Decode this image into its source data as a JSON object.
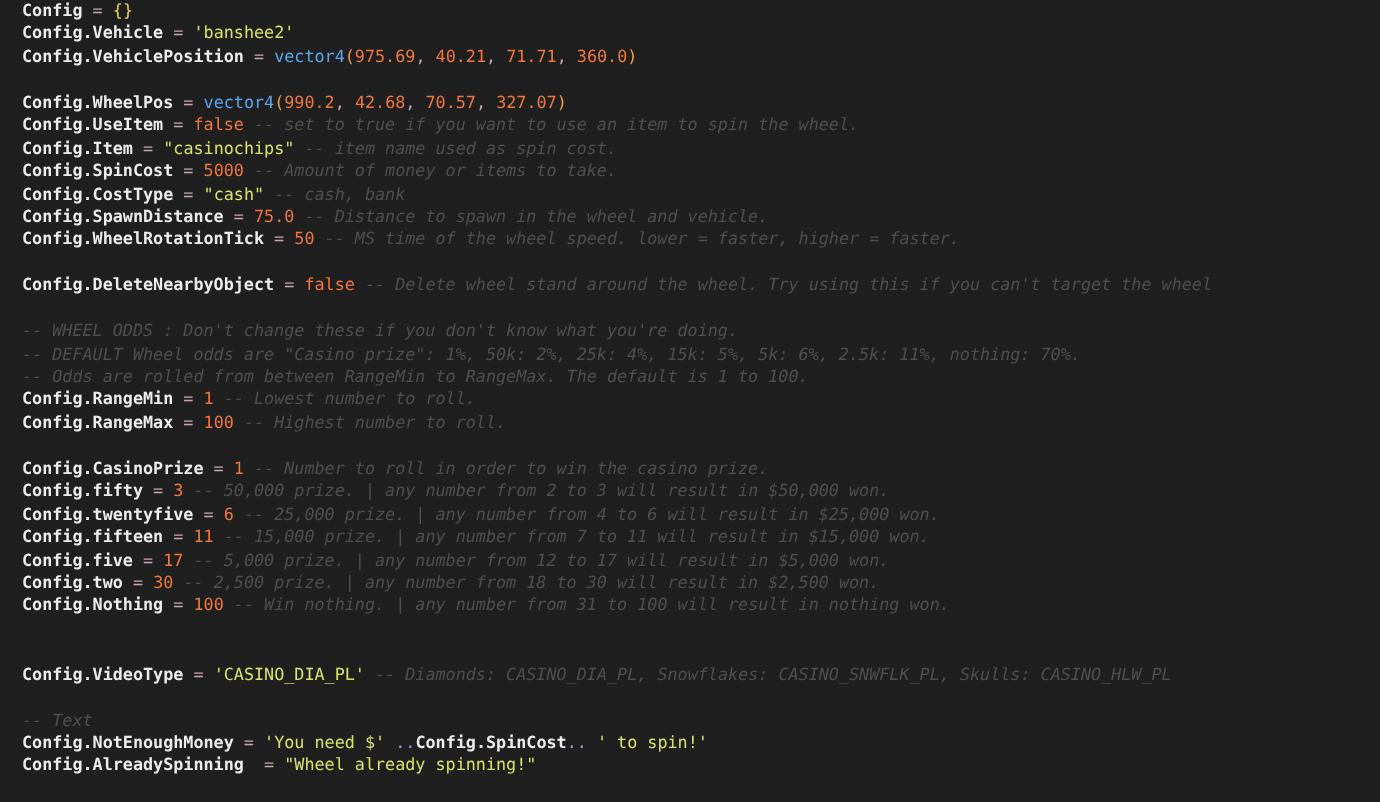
{
  "editor": {
    "lines": [
      {
        "kind": "code",
        "tokens": [
          {
            "kind": "id",
            "text": "Config"
          },
          {
            "kind": "op",
            "text": " = "
          },
          {
            "kind": "brace",
            "text": "{}"
          }
        ]
      },
      {
        "kind": "code",
        "tokens": [
          {
            "kind": "id",
            "text": "Config.Vehicle"
          },
          {
            "kind": "op",
            "text": " = "
          },
          {
            "kind": "str",
            "text": "'banshee2'"
          }
        ]
      },
      {
        "kind": "code",
        "tokens": [
          {
            "kind": "id",
            "text": "Config.VehiclePosition"
          },
          {
            "kind": "op",
            "text": " = "
          },
          {
            "kind": "fn",
            "text": "vector4"
          },
          {
            "kind": "paren",
            "text": "("
          },
          {
            "kind": "num",
            "text": "975.69"
          },
          {
            "kind": "op",
            "text": ", "
          },
          {
            "kind": "num",
            "text": "40.21"
          },
          {
            "kind": "op",
            "text": ", "
          },
          {
            "kind": "num",
            "text": "71.71"
          },
          {
            "kind": "op",
            "text": ", "
          },
          {
            "kind": "num",
            "text": "360.0"
          },
          {
            "kind": "paren",
            "text": ")"
          }
        ]
      },
      {
        "kind": "blank"
      },
      {
        "kind": "code",
        "tokens": [
          {
            "kind": "id",
            "text": "Config.WheelPos"
          },
          {
            "kind": "op",
            "text": " = "
          },
          {
            "kind": "fn",
            "text": "vector4"
          },
          {
            "kind": "paren",
            "text": "("
          },
          {
            "kind": "num",
            "text": "990.2"
          },
          {
            "kind": "op",
            "text": ", "
          },
          {
            "kind": "num",
            "text": "42.68"
          },
          {
            "kind": "op",
            "text": ", "
          },
          {
            "kind": "num",
            "text": "70.57"
          },
          {
            "kind": "op",
            "text": ", "
          },
          {
            "kind": "num",
            "text": "327.07"
          },
          {
            "kind": "paren",
            "text": ")"
          }
        ]
      },
      {
        "kind": "code",
        "tokens": [
          {
            "kind": "id",
            "text": "Config.UseItem"
          },
          {
            "kind": "op",
            "text": " = "
          },
          {
            "kind": "num",
            "text": "false"
          },
          {
            "kind": "comment",
            "text": " -- set to true if you want to use an item to spin the wheel."
          }
        ]
      },
      {
        "kind": "code",
        "tokens": [
          {
            "kind": "id",
            "text": "Config.Item"
          },
          {
            "kind": "op",
            "text": " = "
          },
          {
            "kind": "str",
            "text": "\"casinochips\""
          },
          {
            "kind": "comment",
            "text": " -- item name used as spin cost."
          }
        ]
      },
      {
        "kind": "code",
        "tokens": [
          {
            "kind": "id",
            "text": "Config.SpinCost"
          },
          {
            "kind": "op",
            "text": " = "
          },
          {
            "kind": "num",
            "text": "5000"
          },
          {
            "kind": "comment",
            "text": " -- Amount of money or items to take."
          }
        ]
      },
      {
        "kind": "code",
        "tokens": [
          {
            "kind": "id",
            "text": "Config.CostType"
          },
          {
            "kind": "op",
            "text": " = "
          },
          {
            "kind": "str",
            "text": "\"cash\""
          },
          {
            "kind": "comment",
            "text": " -- cash, bank"
          }
        ]
      },
      {
        "kind": "code",
        "tokens": [
          {
            "kind": "id",
            "text": "Config.SpawnDistance"
          },
          {
            "kind": "op",
            "text": " = "
          },
          {
            "kind": "num",
            "text": "75.0"
          },
          {
            "kind": "comment",
            "text": " -- Distance to spawn in the wheel and vehicle."
          }
        ]
      },
      {
        "kind": "code",
        "tokens": [
          {
            "kind": "id",
            "text": "Config.WheelRotationTick"
          },
          {
            "kind": "op",
            "text": " = "
          },
          {
            "kind": "num",
            "text": "50"
          },
          {
            "kind": "comment",
            "text": " -- MS time of the wheel speed. lower = faster, higher = faster."
          }
        ]
      },
      {
        "kind": "blank"
      },
      {
        "kind": "code",
        "tokens": [
          {
            "kind": "id",
            "text": "Config.DeleteNearbyObject"
          },
          {
            "kind": "op",
            "text": " = "
          },
          {
            "kind": "num",
            "text": "false"
          },
          {
            "kind": "comment",
            "text": " -- Delete wheel stand around the wheel. Try using this if you can't target the wheel"
          }
        ]
      },
      {
        "kind": "blank"
      },
      {
        "kind": "code",
        "tokens": [
          {
            "kind": "comment",
            "text": "-- WHEEL ODDS : Don't change these if you don't know what you're doing."
          }
        ]
      },
      {
        "kind": "code",
        "tokens": [
          {
            "kind": "comment",
            "text": "-- DEFAULT Wheel odds are \"Casino prize\": 1%, 50k: 2%, 25k: 4%, 15k: 5%, 5k: 6%, 2.5k: 11%, nothing: 70%."
          }
        ]
      },
      {
        "kind": "code",
        "tokens": [
          {
            "kind": "comment",
            "text": "-- Odds are rolled from between RangeMin to RangeMax. The default is 1 to 100."
          }
        ]
      },
      {
        "kind": "code",
        "tokens": [
          {
            "kind": "id",
            "text": "Config.RangeMin"
          },
          {
            "kind": "op",
            "text": " = "
          },
          {
            "kind": "num",
            "text": "1"
          },
          {
            "kind": "comment",
            "text": " -- Lowest number to roll."
          }
        ]
      },
      {
        "kind": "code",
        "tokens": [
          {
            "kind": "id",
            "text": "Config.RangeMax"
          },
          {
            "kind": "op",
            "text": " = "
          },
          {
            "kind": "num",
            "text": "100"
          },
          {
            "kind": "comment",
            "text": " -- Highest number to roll."
          }
        ]
      },
      {
        "kind": "blank"
      },
      {
        "kind": "code",
        "tokens": [
          {
            "kind": "id",
            "text": "Config.CasinoPrize"
          },
          {
            "kind": "op",
            "text": " = "
          },
          {
            "kind": "num",
            "text": "1"
          },
          {
            "kind": "comment",
            "text": " -- Number to roll in order to win the casino prize."
          }
        ]
      },
      {
        "kind": "code",
        "tokens": [
          {
            "kind": "id",
            "text": "Config.fifty"
          },
          {
            "kind": "op",
            "text": " = "
          },
          {
            "kind": "num",
            "text": "3"
          },
          {
            "kind": "comment",
            "text": " -- 50,000 prize. | any number from 2 to 3 will result in $50,000 won."
          }
        ]
      },
      {
        "kind": "code",
        "tokens": [
          {
            "kind": "id",
            "text": "Config.twentyfive"
          },
          {
            "kind": "op",
            "text": " = "
          },
          {
            "kind": "num",
            "text": "6"
          },
          {
            "kind": "comment",
            "text": " -- 25,000 prize. | any number from 4 to 6 will result in $25,000 won."
          }
        ]
      },
      {
        "kind": "code",
        "tokens": [
          {
            "kind": "id",
            "text": "Config.fifteen"
          },
          {
            "kind": "op",
            "text": " = "
          },
          {
            "kind": "num",
            "text": "11"
          },
          {
            "kind": "comment",
            "text": " -- 15,000 prize. | any number from 7 to 11 will result in $15,000 won."
          }
        ]
      },
      {
        "kind": "code",
        "tokens": [
          {
            "kind": "id",
            "text": "Config.five"
          },
          {
            "kind": "op",
            "text": " = "
          },
          {
            "kind": "num",
            "text": "17"
          },
          {
            "kind": "comment",
            "text": " -- 5,000 prize. | any number from 12 to 17 will result in $5,000 won."
          }
        ]
      },
      {
        "kind": "code",
        "tokens": [
          {
            "kind": "id",
            "text": "Config.two"
          },
          {
            "kind": "op",
            "text": " = "
          },
          {
            "kind": "num",
            "text": "30"
          },
          {
            "kind": "comment",
            "text": " -- 2,500 prize. | any number from 18 to 30 will result in $2,500 won."
          }
        ]
      },
      {
        "kind": "code",
        "tokens": [
          {
            "kind": "id",
            "text": "Config.Nothing"
          },
          {
            "kind": "op",
            "text": " = "
          },
          {
            "kind": "num",
            "text": "100"
          },
          {
            "kind": "comment",
            "text": " -- Win nothing. | any number from 31 to 100 will result in nothing won."
          }
        ]
      },
      {
        "kind": "blank"
      },
      {
        "kind": "blank"
      },
      {
        "kind": "code",
        "tokens": [
          {
            "kind": "id",
            "text": "Config.VideoType"
          },
          {
            "kind": "op",
            "text": " = "
          },
          {
            "kind": "str",
            "text": "'CASINO_DIA_PL'"
          },
          {
            "kind": "comment",
            "text": " -- Diamonds: CASINO_DIA_PL, Snowflakes: CASINO_SNWFLK_PL, Skulls: CASINO_HLW_PL"
          }
        ]
      },
      {
        "kind": "blank"
      },
      {
        "kind": "code",
        "tokens": [
          {
            "kind": "comment",
            "text": "-- Text"
          }
        ]
      },
      {
        "kind": "code",
        "tokens": [
          {
            "kind": "id",
            "text": "Config.NotEnoughMoney"
          },
          {
            "kind": "op",
            "text": " = "
          },
          {
            "kind": "str",
            "text": "'You need $'"
          },
          {
            "kind": "concat",
            "text": " .."
          },
          {
            "kind": "id",
            "text": "Config.SpinCost"
          },
          {
            "kind": "concat",
            "text": ".. "
          },
          {
            "kind": "str",
            "text": "' to spin!'"
          }
        ]
      },
      {
        "kind": "code",
        "tokens": [
          {
            "kind": "id",
            "text": "Config.AlreadySpinning"
          },
          {
            "kind": "op",
            "text": "  = "
          },
          {
            "kind": "str",
            "text": "\"Wheel already spinning!\""
          }
        ]
      }
    ]
  }
}
